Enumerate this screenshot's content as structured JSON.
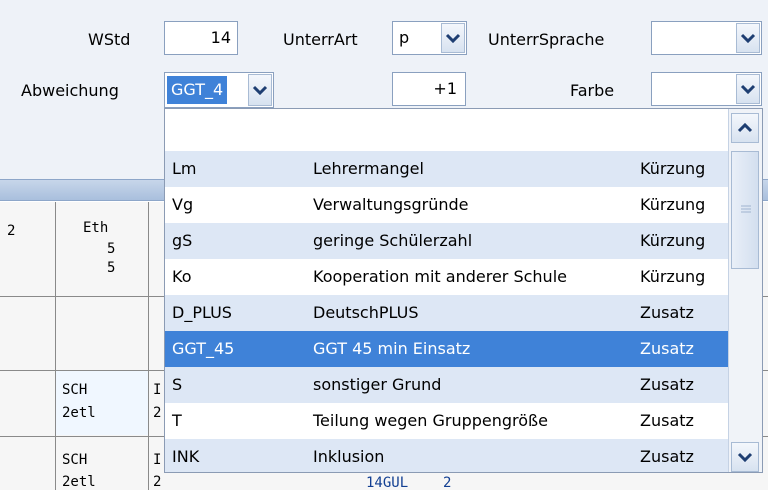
{
  "form": {
    "wstd_label": "WStd",
    "wstd_value": "14",
    "unterrart_label": "UnterrArt",
    "unterrart_value": "p",
    "unterrsprache_label": "UnterrSprache",
    "unterrsprache_value": "",
    "abweichung_label": "Abweichung",
    "abweichung_value": "GGT_4",
    "abweichung_offset": "+1",
    "farbe_label": "Farbe",
    "farbe_value": ""
  },
  "background_grid": {
    "header_cells": [
      "2",
      "Eth"
    ],
    "eth_counts": [
      "5",
      "5"
    ],
    "rows": [
      {
        "c1": "SCH",
        "c1b": "2etl",
        "c2": "I",
        "c2b": "2"
      },
      {
        "c1": "SCH",
        "c1b": "2etl",
        "c2": "I",
        "c2b": "2"
      }
    ],
    "partial_text": "14GUL",
    "partial_text2": "2"
  },
  "dropdown": {
    "items": [
      {
        "code": "Lm",
        "name": "Lehrermangel",
        "type": "Kürzung"
      },
      {
        "code": "Vg",
        "name": "Verwaltungsgründe",
        "type": "Kürzung"
      },
      {
        "code": "gS",
        "name": "geringe Schülerzahl",
        "type": "Kürzung"
      },
      {
        "code": "Ko",
        "name": "Kooperation mit anderer Schule",
        "type": "Kürzung"
      },
      {
        "code": "D_PLUS",
        "name": "DeutschPLUS",
        "type": "Zusatz"
      },
      {
        "code": "GGT_45",
        "name": "GGT 45 min Einsatz",
        "type": "Zusatz"
      },
      {
        "code": "S",
        "name": "sonstiger Grund",
        "type": "Zusatz"
      },
      {
        "code": "T",
        "name": "Teilung wegen Gruppengröße",
        "type": "Zusatz"
      },
      {
        "code": "INK",
        "name": "Inklusion",
        "type": "Zusatz"
      }
    ],
    "selected_index": 5
  },
  "icons": {
    "combo_button": "chevron-down-icon",
    "scroll_up": "chevron-up-icon",
    "scroll_down": "chevron-down-icon",
    "thumb_grip": "grip-icon"
  },
  "colors": {
    "selection": "#3f82d8",
    "alt_row": "#dde7f5",
    "panel_bg": "#eef2f8"
  }
}
